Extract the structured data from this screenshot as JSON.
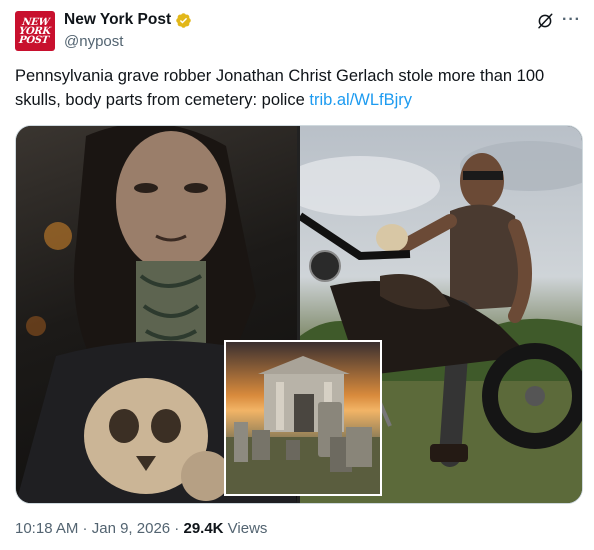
{
  "account": {
    "avatar_text": "NEW YORK POST",
    "name": "New York Post",
    "handle": "@nypost",
    "verified": true
  },
  "tweet": {
    "text": "Pennsylvania grave robber Jonathan Christ Gerlach stole more than 100 skulls, body parts from cemetery: police ",
    "link": "trib.al/WLfBjry"
  },
  "meta": {
    "time": "10:18 AM",
    "sep1": " · ",
    "date": "Jan 9, 2026",
    "sep2": " · ",
    "views_count": "29.4K",
    "views_label": " Views"
  },
  "colors": {
    "link": "#1d9bf0",
    "badge": "#e2b719",
    "secondary": "#536471",
    "avatar_bg": "#c8102e"
  },
  "icons": [
    "verified-badge-icon",
    "grok-icon",
    "more-icon"
  ]
}
